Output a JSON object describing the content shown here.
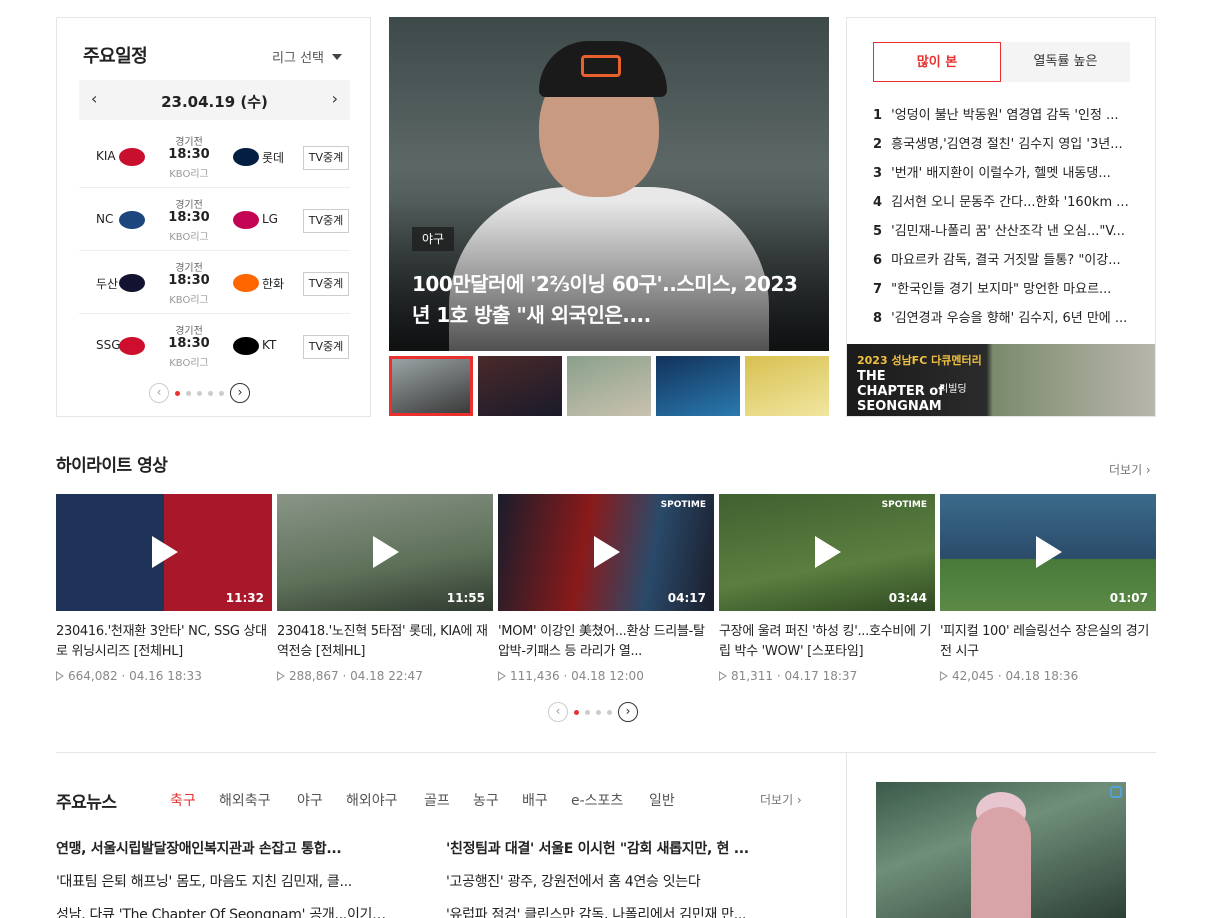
{
  "schedule": {
    "title": "주요일정",
    "league_select": "리그 선택",
    "date": "23.04.19 (수)",
    "prev": "‹",
    "next": "›",
    "games": [
      {
        "home": "KIA",
        "away": "롯데",
        "status": "경기전",
        "time": "18:30",
        "league": "KBO리그",
        "tv": "TV중계",
        "home_color": "#c8102e",
        "away_color": "#041e42"
      },
      {
        "home": "NC",
        "away": "LG",
        "status": "경기전",
        "time": "18:30",
        "league": "KBO리그",
        "tv": "TV중계",
        "home_color": "#1d467f",
        "away_color": "#c30452"
      },
      {
        "home": "두산",
        "away": "한화",
        "status": "경기전",
        "time": "18:30",
        "league": "KBO리그",
        "tv": "TV중계",
        "home_color": "#131230",
        "away_color": "#ff6600"
      },
      {
        "home": "SSG",
        "away": "KT",
        "status": "경기전",
        "time": "18:30",
        "league": "KBO리그",
        "tv": "TV중계",
        "home_color": "#ce0e2d",
        "away_color": "#000000"
      }
    ],
    "pager": {
      "prev": "‹",
      "next": "›",
      "pages": 5,
      "active": 1
    }
  },
  "hero": {
    "badge": "야구",
    "headline": "100만달러에 '2⅔이닝 60구'..스미스, 2023년 1호 방출 \"새 외국인은....",
    "thumb_count": 5
  },
  "ranking": {
    "tab_active": "많이 본",
    "tab_other": "열독률 높은",
    "items": [
      {
        "rank": "1",
        "text": "'엉덩이 불난 박동원' 염경엽 감독 '인정 ..."
      },
      {
        "rank": "2",
        "text": "흥국생명,'김연경 절친' 김수지 영입 '3년..."
      },
      {
        "rank": "3",
        "text": "'번개' 배지환이 이럴수가, 헬멧 내동댕..."
      },
      {
        "rank": "4",
        "text": "김서현 오니 문동주 간다...한화 '160km ..."
      },
      {
        "rank": "5",
        "text": "'김민재-나폴리 꿈' 산산조각 낸 오심...\"V..."
      },
      {
        "rank": "6",
        "text": "마요르카 감독, 결국 거짓말 들통? \"이강..."
      },
      {
        "rank": "7",
        "text": "\"한국인들 경기 보지마\" 망언한 마요르..."
      },
      {
        "rank": "8",
        "text": "'김연경과 우승을 향해' 김수지, 6년 만에 ..."
      }
    ],
    "banner": {
      "line1": "2023 성남FC 다큐멘터리",
      "line2": "THE CHAPTER of SEONGNAM",
      "line3": "리빌딩"
    }
  },
  "highlights": {
    "title": "하이라이트 영상",
    "more": "더보기 ›",
    "videos": [
      {
        "title": "230416.'천재환 3안타' NC, SSG 상대로 위닝시리즈 [전체HL]",
        "views": "664,082",
        "date": "04.16 18:33",
        "duration": "11:32",
        "label": "",
        "bg": "#24324a"
      },
      {
        "title": "230418.'노진혁 5타점' 롯데, KIA에 재역전승 [전체HL]",
        "views": "288,867",
        "date": "04.18 22:47",
        "duration": "11:55",
        "label": "",
        "bg": "#6f7c6a"
      },
      {
        "title": "'MOM' 이강인 美쳤어...환상 드리블-탈압박-키패스 등 라리가 열...",
        "views": "111,436",
        "date": "04.18 12:00",
        "duration": "04:17",
        "label": "SPOTIME",
        "bg": "#1a1d2b"
      },
      {
        "title": "구장에 울려 퍼진 '하성 킹'...호수비에 기립 박수 'WOW' [스포타임]",
        "views": "81,311",
        "date": "04.17 18:37",
        "duration": "03:44",
        "label": "SPOTIME",
        "bg": "#4a6b33"
      },
      {
        "title": "'피지컬 100' 레슬링선수 장은실의 경기 전 시구",
        "views": "42,045",
        "date": "04.18 18:36",
        "duration": "01:07",
        "label": "",
        "bg": "#3b6b8a"
      }
    ],
    "pager": {
      "prev": "‹",
      "next": "›",
      "pages": 4,
      "active": 1
    }
  },
  "news": {
    "title": "주요뉴스",
    "tabs": [
      "축구",
      "해외축구",
      "야구",
      "해외야구",
      "골프",
      "농구",
      "배구",
      "e-스포츠",
      "일반"
    ],
    "active_tab": "축구",
    "more": "더보기 ›",
    "left": [
      "연맹, 서울시립발달장애인복지관과 손잡고 통합...",
      "'대표팀 은퇴 해프닝' 몸도, 마음도 지친 김민재, 클...",
      "성남, 다큐 'The Chapter Of Seongnam' 공개...이기형..."
    ],
    "right": [
      "'친정팀과 대결' 서울E 이시헌 \"감회 새롭지만, 현 ...",
      "'고공행진' 광주, 강원전에서 홈 4연승 잇는다",
      "'유럽파 점검' 클린스만 감독, 나폴리에서 김민재 만..."
    ]
  },
  "colors": {
    "accent": "#e8312f",
    "border": "#e5e5e5"
  }
}
